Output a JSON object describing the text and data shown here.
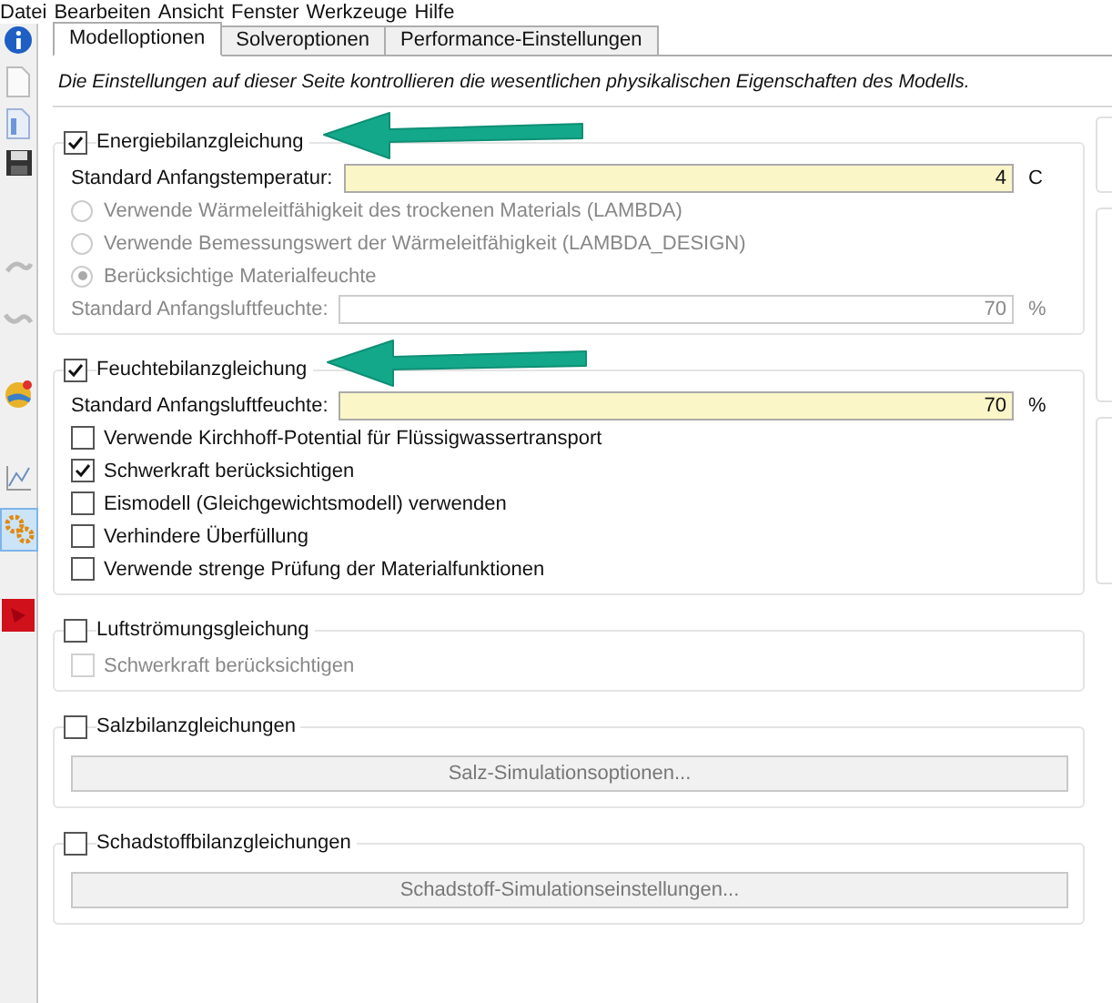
{
  "menu": [
    "Datei",
    "Bearbeiten",
    "Ansicht",
    "Fenster",
    "Werkzeuge",
    "Hilfe"
  ],
  "tabs": [
    {
      "label": "Modelloptionen",
      "selected": true
    },
    {
      "label": "Solveroptionen",
      "selected": false
    },
    {
      "label": "Performance-Einstellungen",
      "selected": false
    }
  ],
  "description": "Die Einstellungen auf dieser Seite kontrollieren die wesentlichen physikalischen Eigenschaften des Modells.",
  "sections": [
    {
      "title": "Energiebilanzgleichung",
      "checked": true,
      "arrow": true,
      "items": [
        {
          "kind": "field",
          "label": "Standard Anfangstemperatur:",
          "value": "4",
          "unit": "C",
          "disabled": false
        },
        {
          "kind": "radio",
          "label": "Verwende Wärmeleitfähigkeit des trockenen Materials (LAMBDA)",
          "selected": false,
          "disabled": true
        },
        {
          "kind": "radio",
          "label": "Verwende Bemessungswert der Wärmeleitfähigkeit (LAMBDA_DESIGN)",
          "selected": false,
          "disabled": true
        },
        {
          "kind": "radio",
          "label": "Berücksichtige Materialfeuchte",
          "selected": true,
          "disabled": true
        },
        {
          "kind": "field",
          "label": "Standard Anfangsluftfeuchte:",
          "value": "70",
          "unit": "%",
          "disabled": true
        }
      ]
    },
    {
      "title": "Feuchtebilanzgleichung",
      "checked": true,
      "arrow": true,
      "items": [
        {
          "kind": "field",
          "label": "Standard Anfangsluftfeuchte:",
          "value": "70",
          "unit": "%",
          "disabled": false
        },
        {
          "kind": "checkbox",
          "label": "Verwende Kirchhoff-Potential für Flüssigwassertransport",
          "checked": false,
          "disabled": false
        },
        {
          "kind": "checkbox",
          "label": "Schwerkraft berücksichtigen",
          "checked": true,
          "disabled": false
        },
        {
          "kind": "checkbox",
          "label": "Eismodell (Gleichgewichtsmodell) verwenden",
          "checked": false,
          "disabled": false
        },
        {
          "kind": "checkbox",
          "label": "Verhindere Überfüllung",
          "checked": false,
          "disabled": false
        },
        {
          "kind": "checkbox",
          "label": "Verwende strenge Prüfung der Materialfunktionen",
          "checked": false,
          "disabled": false
        }
      ]
    },
    {
      "title": "Luftströmungsgleichung",
      "checked": false,
      "arrow": false,
      "items": [
        {
          "kind": "checkbox",
          "label": "Schwerkraft berücksichtigen",
          "checked": false,
          "disabled": true
        }
      ]
    },
    {
      "title": "Salzbilanzgleichungen",
      "checked": false,
      "arrow": false,
      "items": [
        {
          "kind": "button",
          "label": "Salz-Simulationsoptionen...",
          "disabled": true
        }
      ]
    },
    {
      "title": "Schadstoffbilanzgleichungen",
      "checked": false,
      "arrow": false,
      "items": [
        {
          "kind": "button",
          "label": "Schadstoff-Simulationseinstellungen...",
          "disabled": true
        }
      ]
    }
  ],
  "side_panel_visible": true
}
